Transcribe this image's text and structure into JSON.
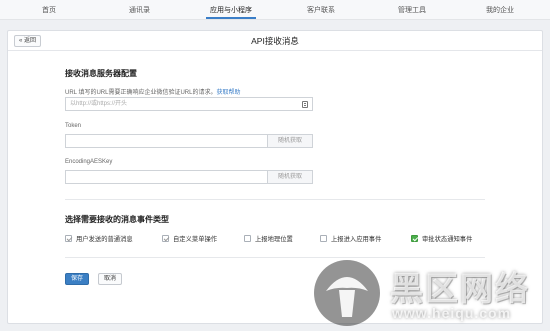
{
  "nav": {
    "tabs": [
      "首页",
      "通讯录",
      "应用与小程序",
      "客户联系",
      "管理工具",
      "我的企业"
    ],
    "active_index": 2
  },
  "header": {
    "back_label": "« 返回",
    "title": "API接收消息"
  },
  "server_config": {
    "title": "接收消息服务器配置",
    "url": {
      "label": "URL  填写的URL需要正确响应企业微信验证URL的请求。",
      "help_link": "获取帮助",
      "placeholder": "以http://或https://开头",
      "icon": "document-icon"
    },
    "token": {
      "label": "Token",
      "value": "",
      "random_button": "随机获取"
    },
    "aes_key": {
      "label": "EncodingAESKey",
      "value": "",
      "random_button": "随机获取"
    }
  },
  "events": {
    "title": "选择需要接收的消息事件类型",
    "options": [
      {
        "label": "用户发送的普通消息",
        "checked": true,
        "style": "gray"
      },
      {
        "label": "自定义菜单操作",
        "checked": true,
        "style": "gray"
      },
      {
        "label": "上报地理位置",
        "checked": false,
        "style": "none"
      },
      {
        "label": "上报进入应用事件",
        "checked": false,
        "style": "none"
      },
      {
        "label": "审批状态通知事件",
        "checked": true,
        "style": "green"
      }
    ]
  },
  "actions": {
    "save_label": "保存",
    "cancel_label": "取消"
  },
  "watermark": {
    "text": "黑区网络",
    "url": "www.heiqu.com"
  },
  "colors": {
    "accent": "#3b7fc4",
    "checked_green": "#4cae4c",
    "page_bg": "#eef0f3"
  }
}
